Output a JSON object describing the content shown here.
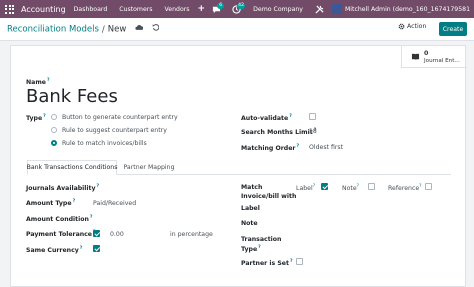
{
  "navbar": {
    "app_name": "Accounting",
    "menus": [
      "Dashboard",
      "Customers",
      "Vendors"
    ],
    "plus": "+",
    "chat_count": "6",
    "activity_count": "42",
    "company": "Demo Company",
    "user": "Mitchell Admin (demo_160_1674179581"
  },
  "control": {
    "breadcrumb_parent": "Reconciliation Models",
    "breadcrumb_sep": "/",
    "breadcrumb_current": "New",
    "action_label": "Action",
    "create_label": "Create"
  },
  "button_box": {
    "count": "0",
    "label": "Journal Ent..."
  },
  "form": {
    "name_label": "Name",
    "name_value": "Bank Fees",
    "type_label": "Type",
    "type_options": [
      {
        "label": "Button to generate counterpart entry",
        "selected": false
      },
      {
        "label": "Rule to suggest counterpart entry",
        "selected": false
      },
      {
        "label": "Rule to match invoices/bills",
        "selected": true
      }
    ],
    "auto_validate_label": "Auto-validate",
    "auto_validate": false,
    "search_months_label": "Search Months Limit",
    "search_months_value": "18",
    "matching_order_label": "Matching Order",
    "matching_order_value": "Oldest first"
  },
  "tabs": [
    "Bank Transactions Conditions",
    "Partner Mapping"
  ],
  "conditions": {
    "journals_label": "Journals Availability",
    "amount_type_label": "Amount Type",
    "amount_type_value": "Paid/Received",
    "amount_condition_label": "Amount Condition",
    "payment_tolerance_label": "Payment Tolerance",
    "payment_tolerance_checked": true,
    "payment_tolerance_value": "0.00",
    "payment_tolerance_unit": "in percentage",
    "same_currency_label": "Same Currency",
    "same_currency_checked": true,
    "match_label_line1": "Match",
    "match_label_line2": "Invoice/bill with",
    "match_label_line3": "Label",
    "match_options": [
      {
        "label": "Label",
        "checked": true
      },
      {
        "label": "Note",
        "checked": false
      },
      {
        "label": "Reference",
        "checked": false
      }
    ],
    "label_label": "Label",
    "note_label": "Note",
    "transaction_type_line1": "Transaction",
    "transaction_type_line2": "Type",
    "partner_is_set_label": "Partner is Set",
    "partner_is_set_checked": false
  },
  "colors": {
    "navbar": "#714b67",
    "accent": "#017e84"
  }
}
